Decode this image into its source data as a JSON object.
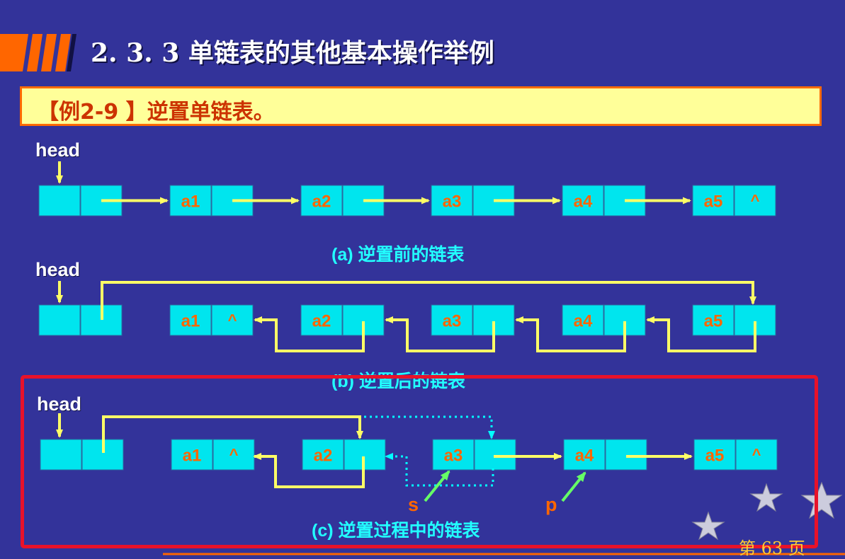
{
  "header": {
    "title": "2. 3. 3   单链表的其他基本操作举例"
  },
  "example": {
    "text": "【例2-9 】逆置单链表。"
  },
  "diagram_a": {
    "head_label": "head",
    "caption": "(a) 逆置前的链表",
    "nodes": [
      {
        "data": "a1",
        "next": ""
      },
      {
        "data": "a2",
        "next": ""
      },
      {
        "data": "a3",
        "next": ""
      },
      {
        "data": "a4",
        "next": ""
      },
      {
        "data": "a5",
        "next": "^"
      }
    ]
  },
  "diagram_b": {
    "head_label": "head",
    "caption": "(b) 逆置后的链表",
    "nodes": [
      {
        "data": "a1",
        "next": "^"
      },
      {
        "data": "a2",
        "next": ""
      },
      {
        "data": "a3",
        "next": ""
      },
      {
        "data": "a4",
        "next": ""
      },
      {
        "data": "a5",
        "next": ""
      }
    ]
  },
  "diagram_c": {
    "head_label": "head",
    "caption": "(c) 逆置过程中的链表",
    "pointer_s": "s",
    "pointer_p": "p",
    "nodes": [
      {
        "data": "a1",
        "next": "^"
      },
      {
        "data": "a2",
        "next": ""
      },
      {
        "data": "a3",
        "next": ""
      },
      {
        "data": "a4",
        "next": ""
      },
      {
        "data": "a5",
        "next": "^"
      }
    ]
  },
  "footer": {
    "page": "第  63  页"
  },
  "colors": {
    "background": "#33339a",
    "node_fill": "#00e5ee",
    "node_text": "#ff6600",
    "arrow": "#ffff66",
    "pointer_arrow": "#66ff66",
    "dotted_arrow": "#00ffff",
    "highlight_frame": "#e8122a"
  }
}
